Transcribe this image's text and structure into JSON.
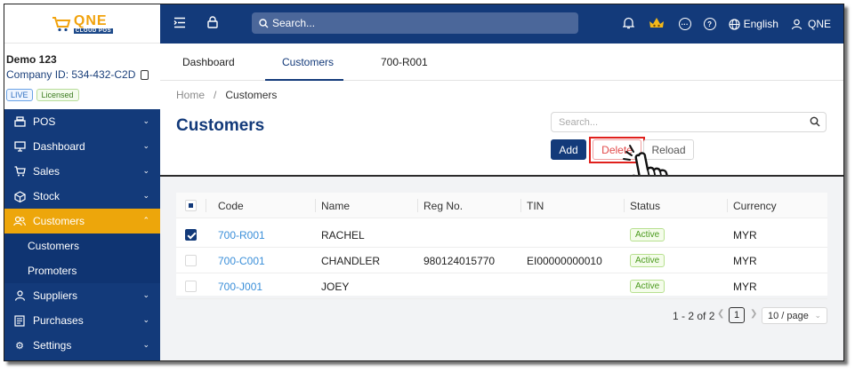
{
  "app": {
    "logo_main": "QNE",
    "logo_sub": "CLOUD POS"
  },
  "company": {
    "name": "Demo 123",
    "id_text": "Company ID: 534-432-C2D",
    "badge_live": "LIVE",
    "badge_licensed": "Licensed"
  },
  "sidebar": {
    "items": [
      {
        "label": "POS",
        "icon": "register-icon"
      },
      {
        "label": "Dashboard",
        "icon": "monitor-icon"
      },
      {
        "label": "Sales",
        "icon": "cart-icon"
      },
      {
        "label": "Stock",
        "icon": "box-icon"
      },
      {
        "label": "Customers",
        "icon": "users-icon",
        "active": true
      },
      {
        "label": "Customers",
        "sub": true
      },
      {
        "label": "Promoters",
        "sub": true
      },
      {
        "label": "Suppliers",
        "icon": "supplier-icon"
      },
      {
        "label": "Purchases",
        "icon": "document-icon"
      },
      {
        "label": "Settings",
        "icon": "gear-icon"
      }
    ]
  },
  "topbar": {
    "search_placeholder": "Search...",
    "language": "English",
    "user": "QNE"
  },
  "tabs": [
    "Dashboard",
    "Customers",
    "700-R001"
  ],
  "breadcrumb": {
    "home": "Home",
    "separator": "/",
    "current": "Customers"
  },
  "page": {
    "title": "Customers",
    "search_placeholder": "Search...",
    "add_label": "Add",
    "delete_label": "Delete",
    "reload_label": "Reload"
  },
  "table": {
    "columns": [
      "Code",
      "Name",
      "Reg No.",
      "TIN",
      "Status",
      "Currency"
    ],
    "rows": [
      {
        "checked": true,
        "code": "700-R001",
        "name": "RACHEL",
        "reg_no": "",
        "tin": "",
        "status": "Active",
        "currency": "MYR"
      },
      {
        "checked": false,
        "code": "700-C001",
        "name": "CHANDLER",
        "reg_no": "980124015770",
        "tin": "EI00000000010",
        "status": "Active",
        "currency": "MYR"
      },
      {
        "checked": false,
        "code": "700-J001",
        "name": "JOEY",
        "reg_no": "",
        "tin": "",
        "status": "Active",
        "currency": "MYR"
      }
    ]
  },
  "pagination": {
    "range": "1 - 2 of 2",
    "page": "1",
    "page_size": "10 / page"
  },
  "colors": {
    "navy": "#133a7a",
    "accent": "#eda60b",
    "link": "#3b8fd9",
    "danger": "#e0201c"
  }
}
